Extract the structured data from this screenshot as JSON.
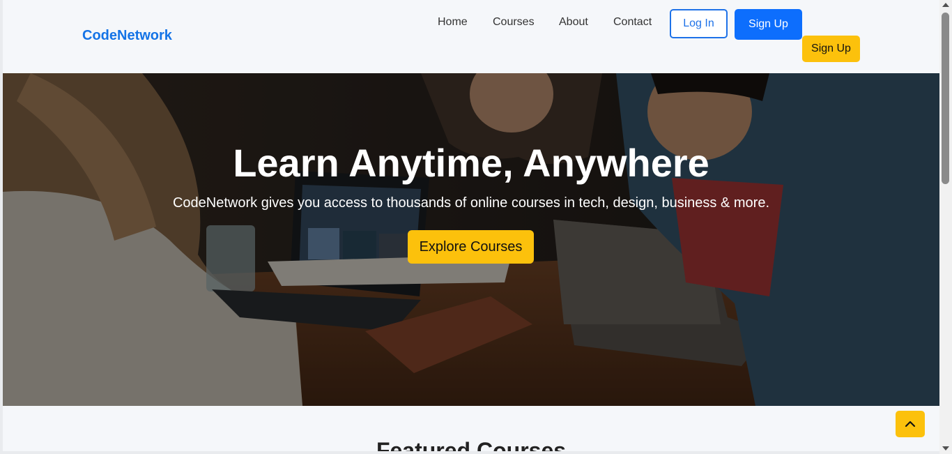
{
  "brand": {
    "name": "CodeNetwork",
    "color": "#1473e6"
  },
  "nav": {
    "items": [
      {
        "label": "Home"
      },
      {
        "label": "Courses"
      },
      {
        "label": "About"
      },
      {
        "label": "Contact"
      }
    ],
    "login_label": "Log In",
    "signup_label": "Sign Up",
    "signup_alt_label": "Sign Up"
  },
  "hero": {
    "title": "Learn Anytime, Anywhere",
    "subtitle": "CodeNetwork gives you access to thousands of online courses in tech, design, business & more.",
    "cta_label": "Explore Courses"
  },
  "featured": {
    "title": "Featured Courses"
  },
  "icons": {
    "back_to_top": "chevron-up-icon"
  },
  "colors": {
    "primary": "#0d6efd",
    "accent": "#fcc10c",
    "background": "#f5f7fa"
  }
}
